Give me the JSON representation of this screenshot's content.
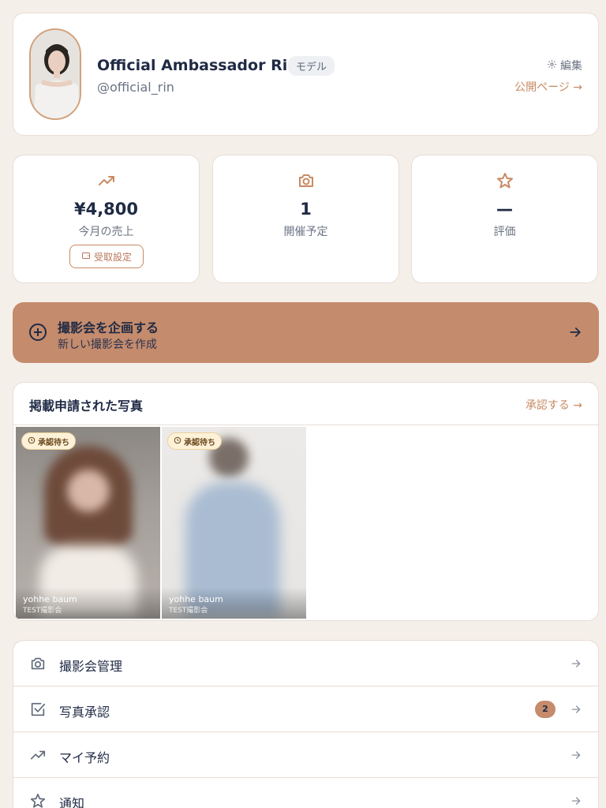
{
  "profile": {
    "name": "Official Ambassador Rin",
    "role": "モデル",
    "handle": "@official_rin",
    "edit_label": "編集",
    "public_page_label": "公開ページ →"
  },
  "stats": [
    {
      "icon": "trending-up-icon",
      "value": "¥4,800",
      "label": "今月の売上",
      "button": "受取設定"
    },
    {
      "icon": "camera-icon",
      "value": "1",
      "label": "開催予定"
    },
    {
      "icon": "star-icon",
      "value": "—",
      "label": "評価"
    }
  ],
  "cta": {
    "title": "撮影会を企画する",
    "subtitle": "新しい撮影会を作成"
  },
  "photo_section": {
    "title": "掲載申請された写真",
    "link_label": "承認する →",
    "photos": [
      {
        "status": "承認待ち",
        "photographer": "yohhe baum",
        "event": "TEST撮影会"
      },
      {
        "status": "承認待ち",
        "photographer": "yohhe baum",
        "event": "TEST撮影会"
      }
    ]
  },
  "menu": [
    {
      "icon": "camera-icon",
      "label": "撮影会管理"
    },
    {
      "icon": "checkbox-icon",
      "label": "写真承認",
      "badge": "2"
    },
    {
      "icon": "trending-up-icon",
      "label": "マイ予約"
    },
    {
      "icon": "star-icon",
      "label": "通知"
    }
  ],
  "colors": {
    "background": "#f5efea",
    "accent": "#c48b6c",
    "accent_text": "#c88a62",
    "text_primary": "#1f2a44",
    "text_secondary": "#6b7383"
  }
}
